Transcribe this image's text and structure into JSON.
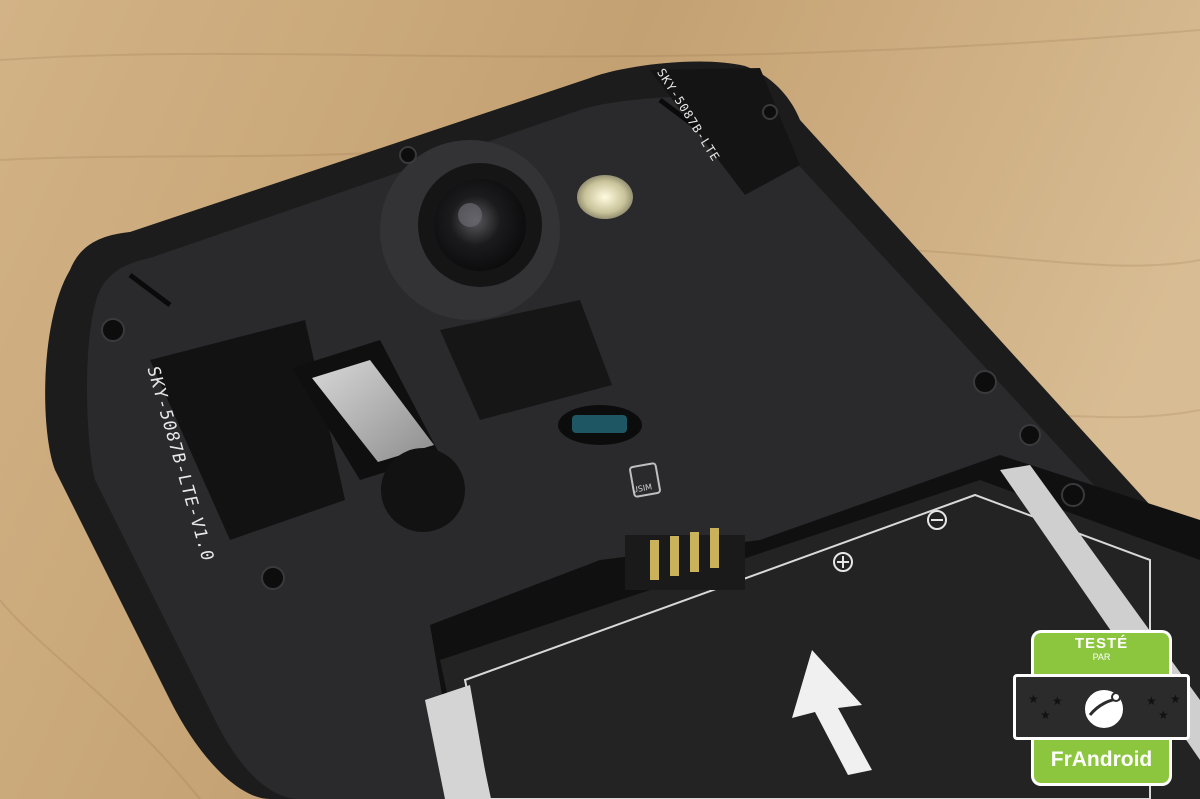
{
  "photo": {
    "subject": "smartphone-back-with-battery",
    "antenna_label": "SKY-5087B-LTE-V1.0",
    "top_label": "SKY-5087B-LTE",
    "sim_slot_label": "USIM",
    "battery_plus_symbol": "⊕",
    "battery_minus_symbol": "⊖"
  },
  "badge": {
    "line1": "TESTÉ",
    "line2": "PAR",
    "brand": "FrAndroid",
    "accent_color": "#8cc63f",
    "dark_color": "#2b2b2b"
  },
  "colors": {
    "table": "#c9a879",
    "phone_body": "#1f1f20",
    "battery": "#232324"
  }
}
